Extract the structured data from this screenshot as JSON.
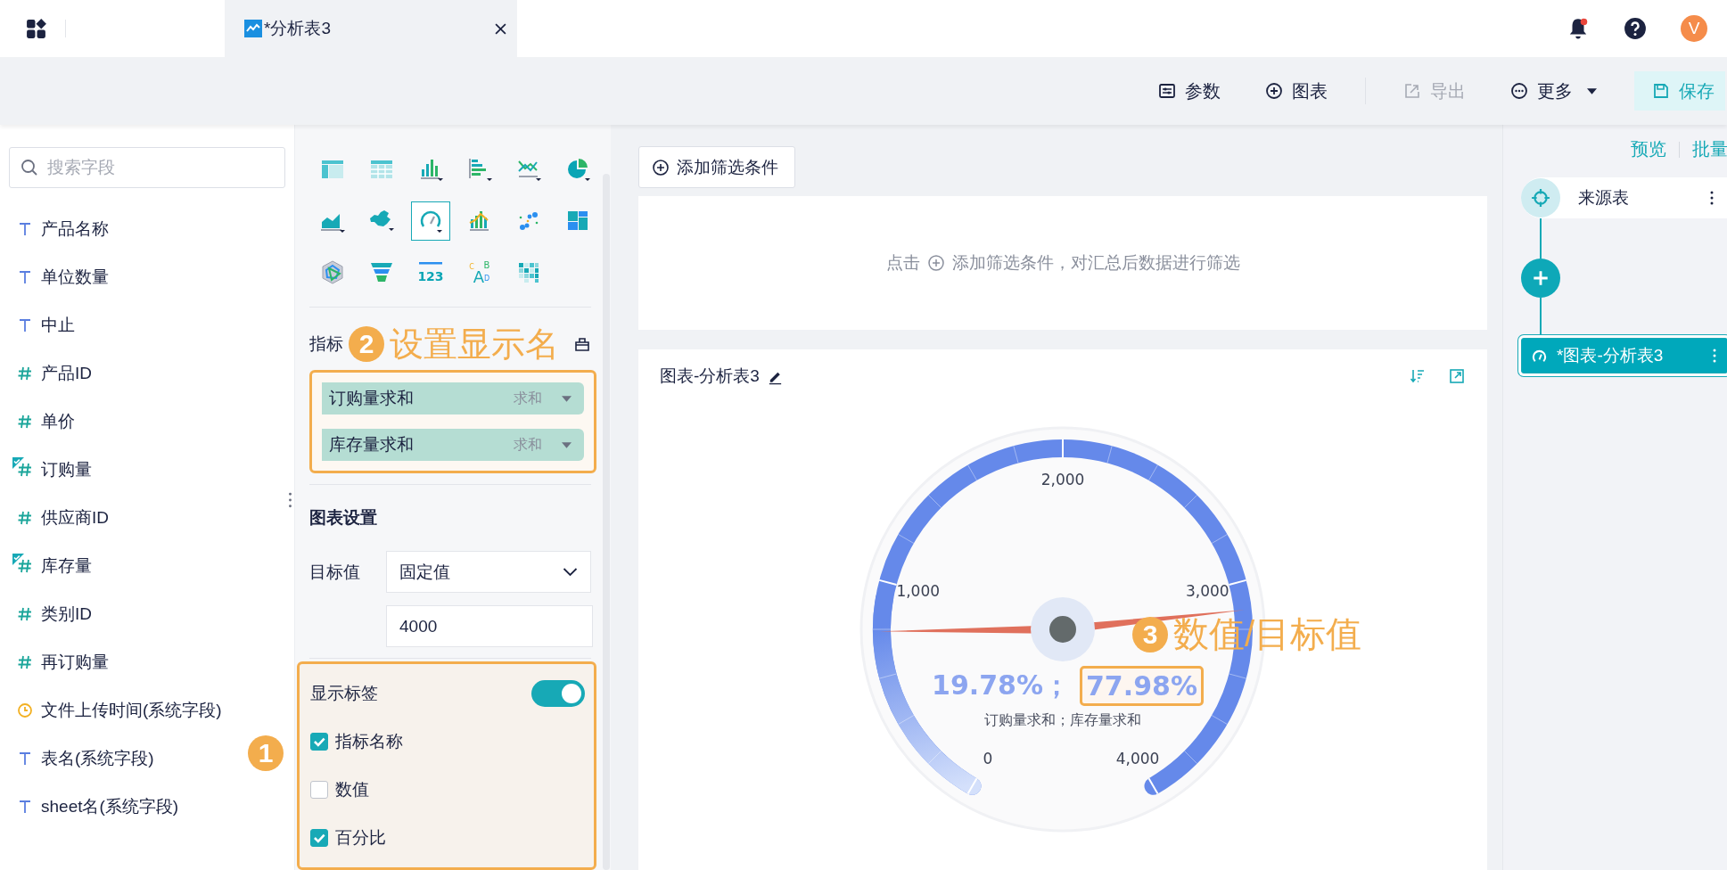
{
  "top_bar": {
    "tabs": [
      {
        "title": "*分析表3",
        "selected": true
      }
    ],
    "notifications_unread": true,
    "avatar": "V"
  },
  "toolbar": [
    {
      "kind": "params",
      "label": "参数",
      "disabled": false
    },
    {
      "kind": "chart",
      "label": "图表",
      "disabled": false
    },
    {
      "kind": "export",
      "label": "导出",
      "disabled": true
    },
    {
      "kind": "more",
      "label": "更多",
      "disabled": false
    },
    {
      "kind": "save",
      "label": "保存",
      "disabled": false
    }
  ],
  "fields": {
    "search": {
      "placeholder": "搜索字段"
    },
    "items": [
      {
        "name": "产品名称",
        "kind": "text",
        "used": false
      },
      {
        "name": "单位数量",
        "kind": "text",
        "used": false
      },
      {
        "name": "中止",
        "kind": "text",
        "used": false
      },
      {
        "name": "产品ID",
        "kind": "number",
        "used": false
      },
      {
        "name": "单价",
        "kind": "number",
        "used": false
      },
      {
        "name": "订购量",
        "kind": "number",
        "used": true
      },
      {
        "name": "供应商ID",
        "kind": "number",
        "used": false
      },
      {
        "name": "库存量",
        "kind": "number",
        "used": true
      },
      {
        "name": "类别ID",
        "kind": "number",
        "used": false
      },
      {
        "name": "再订购量",
        "kind": "number",
        "used": false
      },
      {
        "name": "文件上传时间(系统字段)",
        "kind": "time",
        "used": false
      },
      {
        "name": "表名(系统字段)",
        "kind": "text",
        "used": false
      },
      {
        "name": "sheet名(系统字段)",
        "kind": "text",
        "used": false
      }
    ]
  },
  "chart_types": [
    {
      "kind": "table",
      "selected": false
    },
    {
      "kind": "cross_table",
      "selected": false
    },
    {
      "kind": "bar",
      "selected": false
    },
    {
      "kind": "horizontal_bar",
      "selected": false
    },
    {
      "kind": "line",
      "selected": false
    },
    {
      "kind": "pie",
      "selected": false
    },
    {
      "kind": "area",
      "selected": false
    },
    {
      "kind": "map",
      "selected": false
    },
    {
      "kind": "gauge",
      "selected": true
    },
    {
      "kind": "combo",
      "selected": false
    },
    {
      "kind": "scatter",
      "selected": false
    },
    {
      "kind": "treemap",
      "selected": false
    },
    {
      "kind": "radar",
      "selected": false
    },
    {
      "kind": "funnel",
      "selected": false
    },
    {
      "kind": "number",
      "selected": false,
      "text": "123"
    },
    {
      "kind": "wordcloud",
      "selected": false,
      "text": "CABD"
    },
    {
      "kind": "heatmap",
      "selected": false
    }
  ],
  "metrics": {
    "label": "指标",
    "highlighted": true,
    "annotation": {
      "number": "2",
      "text": "设置显示名"
    },
    "items": [
      {
        "name": "订购量求和",
        "aggregation": "求和"
      },
      {
        "name": "库存量求和",
        "aggregation": "求和"
      }
    ]
  },
  "chart_settings": {
    "title": "图表设置",
    "target_label": "目标值",
    "target_mode": "固定值",
    "target_value": "4000",
    "labels": {
      "highlighted": true,
      "annotation": {
        "number": "1"
      },
      "title": "显示标签",
      "on": true,
      "options": [
        {
          "label": "指标名称",
          "checked": true
        },
        {
          "label": "数值",
          "checked": false
        },
        {
          "label": "百分比",
          "checked": true
        }
      ]
    }
  },
  "filter": {
    "button": "添加筛选条件",
    "hint_before": "点击",
    "hint_after": "添加筛选条件，对汇总后数据进行筛选"
  },
  "chart": {
    "title": "图表-分析表3",
    "gauge": {
      "ticks": [
        "0",
        "1,000",
        "2,000",
        "3,000",
        "4,000"
      ],
      "needles": [
        {
          "level": 0.1978
        },
        {
          "level": 0.7798
        }
      ],
      "values": [
        {
          "text": "19.78%；",
          "highlighted": false
        },
        {
          "text": "77.98%",
          "highlighted": true
        }
      ],
      "caption": "订购量求和；库存量求和",
      "annotation": {
        "number": "3",
        "text": "数值/目标值"
      }
    }
  },
  "flow": {
    "links": [
      "预览",
      "批量"
    ],
    "nodes": [
      {
        "kind": "source",
        "label": "来源表",
        "selected": false
      },
      {
        "kind": "add",
        "selected": false
      },
      {
        "kind": "chart",
        "label": "*图表-分析表3",
        "selected": true
      }
    ]
  }
}
